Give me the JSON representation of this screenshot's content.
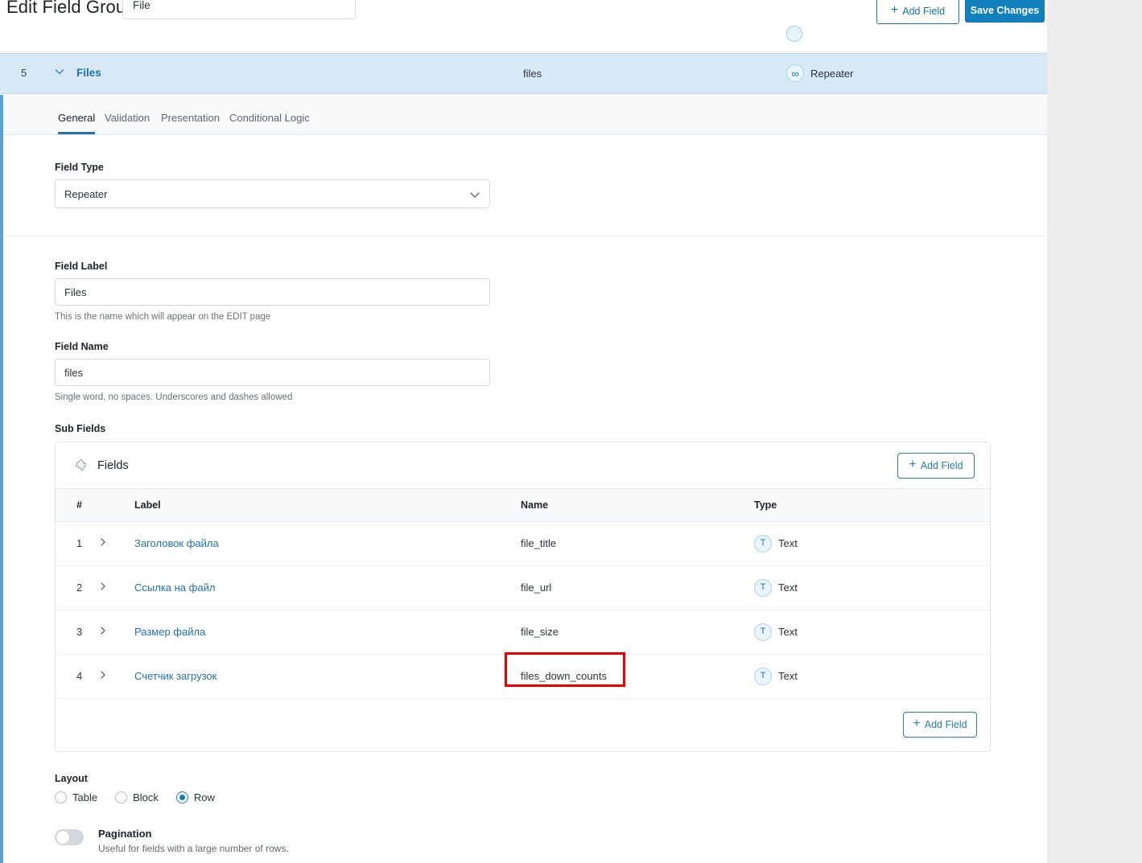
{
  "header": {
    "page_title": "Edit Field Group",
    "title_input_value": "File",
    "add_field_label": "Add Field",
    "save_label": "Save Changes",
    "plus_icon": "+"
  },
  "field_row": {
    "number": "5",
    "label": "Files",
    "name": "files",
    "type": "Repeater",
    "type_icon_glyph": "∞"
  },
  "tabs": [
    {
      "label": "General"
    },
    {
      "label": "Validation"
    },
    {
      "label": "Presentation"
    },
    {
      "label": "Conditional Logic"
    }
  ],
  "general": {
    "field_type_label": "Field Type",
    "field_type_value": "Repeater",
    "field_type_options": [
      "Repeater"
    ],
    "field_label_label": "Field Label",
    "field_label_value": "Files",
    "field_label_hint": "This is the name which will appear on the EDIT page",
    "field_name_label": "Field Name",
    "field_name_value": "files",
    "field_name_hint": "Single word, no spaces. Underscores and dashes allowed",
    "sub_fields_label": "Sub Fields"
  },
  "sub_fields_card": {
    "title": "Fields",
    "add_field_label": "Add Field",
    "add_field_label_bottom": "Add Field",
    "columns": [
      "#",
      "Label",
      "Name",
      "Type"
    ],
    "rows": [
      {
        "num": "1",
        "label": "Заголовок файла",
        "name": "file_title",
        "type": "Text",
        "type_icon_glyph": "T"
      },
      {
        "num": "2",
        "label": "Ссылка на файл",
        "name": "file_url",
        "type": "Text",
        "type_icon_glyph": "T"
      },
      {
        "num": "3",
        "label": "Размер файла",
        "name": "file_size",
        "type": "Text",
        "type_icon_glyph": "T"
      },
      {
        "num": "4",
        "label": "Счетчик загрузок",
        "name": "files_down_counts",
        "type": "Text",
        "type_icon_glyph": "T"
      }
    ]
  },
  "layout": {
    "label": "Layout",
    "options": [
      {
        "label": "Table",
        "selected": false
      },
      {
        "label": "Block",
        "selected": false
      },
      {
        "label": "Row",
        "selected": true
      }
    ]
  },
  "pagination": {
    "title": "Pagination",
    "hint": "Useful for fields with a large number of rows.",
    "enabled": false
  },
  "annotation": {
    "color": "#ee0000",
    "target": "files_down_counts"
  },
  "colors": {
    "accent": "#1180bd",
    "link": "#1b72b8",
    "selected_row_bg": "#d7e9f5",
    "panel_border": "#5aa4ce",
    "page_bg": "#ededed"
  }
}
